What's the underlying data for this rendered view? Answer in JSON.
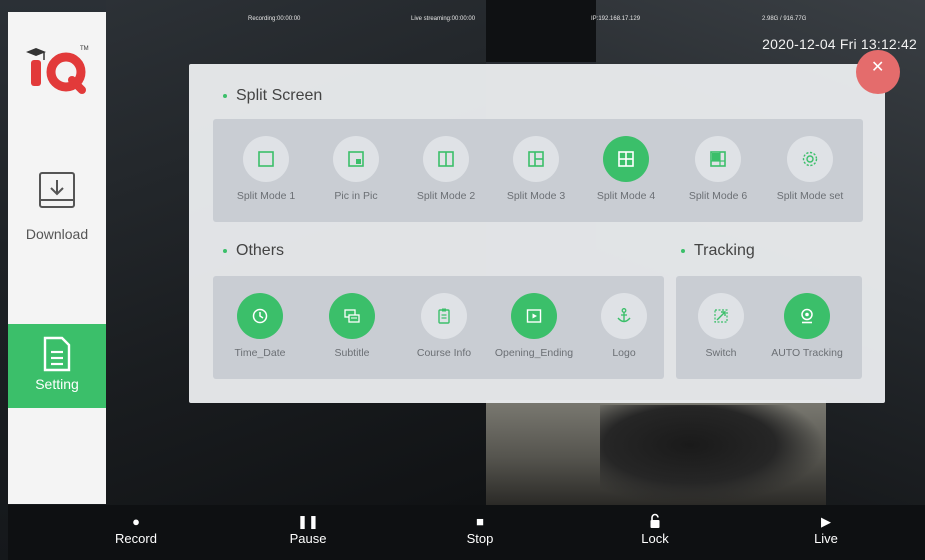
{
  "status": {
    "recording": "Recording:00:00:00",
    "live_streaming": "Live streaming:00:00:00",
    "ip": "IP:192.168.17.129",
    "disk": "2.98G / 916.77G",
    "datetime": "2020-12-04 Fri 13:12:42"
  },
  "sidebar": {
    "logo_text": "iQ",
    "items": [
      {
        "label": "Download",
        "icon": "download-icon",
        "active": false
      },
      {
        "label": "Setting",
        "icon": "document-icon",
        "active": true
      }
    ]
  },
  "panel": {
    "split_screen": {
      "title": "Split Screen",
      "options": [
        {
          "label": "Split Mode 1",
          "icon": "single-square-icon",
          "active": false
        },
        {
          "label": "Pic in Pic",
          "icon": "pip-icon",
          "active": false
        },
        {
          "label": "Split Mode 2",
          "icon": "two-columns-icon",
          "active": false
        },
        {
          "label": "Split Mode 3",
          "icon": "three-split-icon",
          "active": false
        },
        {
          "label": "Split Mode 4",
          "icon": "four-grid-icon",
          "active": true
        },
        {
          "label": "Split Mode 6",
          "icon": "six-grid-icon",
          "active": false
        },
        {
          "label": "Split Mode set",
          "icon": "gear-icon",
          "active": false
        }
      ]
    },
    "others": {
      "title": "Others",
      "options": [
        {
          "label": "Time_Date",
          "icon": "clock-icon",
          "active": true
        },
        {
          "label": "Subtitle",
          "icon": "subtitle-icon",
          "active": true
        },
        {
          "label": "Course Info",
          "icon": "clipboard-icon",
          "active": false
        },
        {
          "label": "Opening_Ending",
          "icon": "play-icon",
          "active": true
        },
        {
          "label": "Logo",
          "icon": "anchor-icon",
          "active": false
        }
      ]
    },
    "tracking": {
      "title": "Tracking",
      "options": [
        {
          "label": "Switch",
          "icon": "switch-arrows-icon",
          "active": false
        },
        {
          "label": "AUTO Tracking",
          "icon": "webcam-icon",
          "active": true
        }
      ]
    },
    "close_glyph": "✕"
  },
  "bottom_bar": {
    "record": "Record",
    "pause": "Pause",
    "stop": "Stop",
    "lock": "Lock",
    "live": "Live"
  },
  "colors": {
    "accent": "#3bbf6a",
    "close": "#e46c6c",
    "panel_bg": "#eceef0",
    "group_bg": "#c9cdd3"
  }
}
